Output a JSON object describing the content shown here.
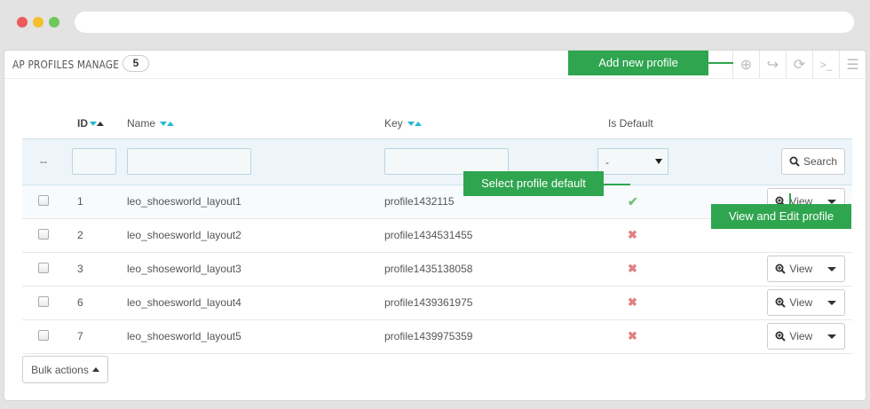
{
  "panel": {
    "title": "AP PROFILES MANAGE",
    "count": "5"
  },
  "toolbar": [
    {
      "icon": "plus-circle-icon",
      "glyph": "⊕"
    },
    {
      "icon": "export-icon",
      "glyph": "↪"
    },
    {
      "icon": "refresh-icon",
      "glyph": "⟳"
    },
    {
      "icon": "terminal-icon",
      "glyph": ">_"
    },
    {
      "icon": "database-icon",
      "glyph": "☰"
    }
  ],
  "callouts": {
    "add": "Add new profile",
    "default": "Select profile default",
    "view": "View and Edit profile"
  },
  "columns": {
    "id": "ID",
    "name": "Name",
    "key": "Key",
    "is_default": "Is Default"
  },
  "filter": {
    "placeholder_dash": "--",
    "select_value": "-",
    "search_label": "Search"
  },
  "rows": [
    {
      "id": "1",
      "name": "leo_shoesworld_layout1",
      "key": "profile1432115",
      "is_default": "check"
    },
    {
      "id": "2",
      "name": "leo_shoesworld_layout2",
      "key": "profile1434531455",
      "is_default": "cross"
    },
    {
      "id": "3",
      "name": "leo_shoseworld_layout3",
      "key": "profile1435138058",
      "is_default": "cross"
    },
    {
      "id": "6",
      "name": "leo_shoesworld_layout4",
      "key": "profile1439361975",
      "is_default": "cross"
    },
    {
      "id": "7",
      "name": "leo_shoesworld_layout5",
      "key": "profile1439975359",
      "is_default": "cross"
    }
  ],
  "view_label": "View",
  "bulk_label": "Bulk actions",
  "colors": {
    "accent_green": "#2fa54f",
    "sort_arrow": "#25b9d7",
    "ok": "#72c279",
    "cross": "#e08080"
  }
}
